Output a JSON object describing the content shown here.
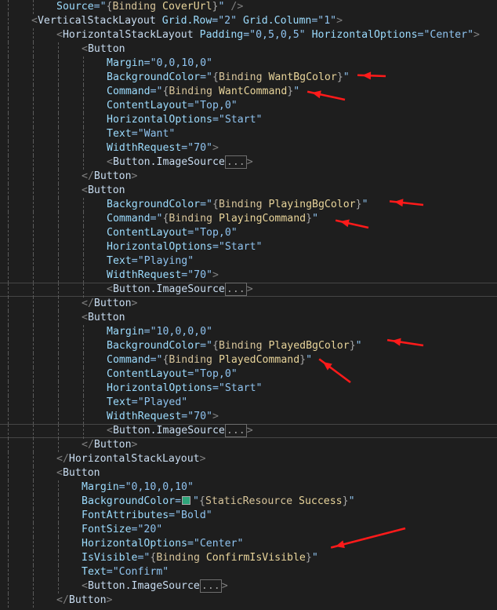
{
  "editor": {
    "accent_arrow": "#ff1a1a",
    "lines": [
      {
        "i": 2,
        "t": [
          [
            "a",
            "Source"
          ],
          [
            "q",
            "=\""
          ],
          [
            "m",
            "{"
          ],
          [
            "k",
            "Binding "
          ],
          [
            "n",
            "CoverUrl"
          ],
          [
            "m",
            "}"
          ],
          [
            "q",
            "\""
          ],
          [
            "b",
            " />"
          ]
        ]
      },
      {
        "i": 1,
        "t": [
          [
            "b",
            "<"
          ],
          [
            "e",
            "VerticalStackLayout"
          ],
          [
            "a",
            " Grid.Row"
          ],
          [
            "q",
            "=\"2\""
          ],
          [
            "a",
            " Grid.Column"
          ],
          [
            "q",
            "=\"1\""
          ],
          [
            "b",
            ">"
          ]
        ]
      },
      {
        "i": 2,
        "t": [
          [
            "b",
            "<"
          ],
          [
            "e",
            "HorizontalStackLayout"
          ],
          [
            "a",
            " Padding"
          ],
          [
            "q",
            "=\"0,5,0,5\""
          ],
          [
            "a",
            " HorizontalOptions"
          ],
          [
            "q",
            "=\"Center\""
          ],
          [
            "b",
            ">"
          ]
        ]
      },
      {
        "i": 3,
        "t": [
          [
            "b",
            "<"
          ],
          [
            "e",
            "Button"
          ]
        ]
      },
      {
        "i": 4,
        "t": [
          [
            "a",
            "Margin"
          ],
          [
            "q",
            "=\"0,0,10,0\""
          ]
        ]
      },
      {
        "i": 4,
        "t": [
          [
            "a",
            "BackgroundColor"
          ],
          [
            "q",
            "=\""
          ],
          [
            "m",
            "{"
          ],
          [
            "k",
            "Binding "
          ],
          [
            "n",
            "WantBgColor"
          ],
          [
            "m",
            "}"
          ],
          [
            "q",
            "\""
          ]
        ]
      },
      {
        "i": 4,
        "t": [
          [
            "a",
            "Command"
          ],
          [
            "q",
            "=\""
          ],
          [
            "m",
            "{"
          ],
          [
            "k",
            "Binding "
          ],
          [
            "n",
            "WantCommand"
          ],
          [
            "m",
            "}"
          ],
          [
            "q",
            "\""
          ]
        ]
      },
      {
        "i": 4,
        "t": [
          [
            "a",
            "ContentLayout"
          ],
          [
            "q",
            "=\"Top,0\""
          ]
        ]
      },
      {
        "i": 4,
        "t": [
          [
            "a",
            "HorizontalOptions"
          ],
          [
            "q",
            "=\"Start\""
          ]
        ]
      },
      {
        "i": 4,
        "t": [
          [
            "a",
            "Text"
          ],
          [
            "q",
            "=\"Want\""
          ]
        ]
      },
      {
        "i": 4,
        "t": [
          [
            "a",
            "WidthRequest"
          ],
          [
            "q",
            "=\"70\""
          ],
          [
            "b",
            ">"
          ]
        ]
      },
      {
        "i": 4,
        "t": [
          [
            "b",
            "<"
          ],
          [
            "e",
            "Button.ImageSource"
          ],
          [
            "fold",
            "..."
          ],
          [
            "b",
            ">"
          ]
        ]
      },
      {
        "i": 3,
        "t": [
          [
            "b",
            "</"
          ],
          [
            "e",
            "Button"
          ],
          [
            "b",
            ">"
          ]
        ]
      },
      {
        "i": 3,
        "t": [
          [
            "b",
            "<"
          ],
          [
            "e",
            "Button"
          ]
        ]
      },
      {
        "i": 4,
        "t": [
          [
            "a",
            "BackgroundColor"
          ],
          [
            "q",
            "=\""
          ],
          [
            "m",
            "{"
          ],
          [
            "k",
            "Binding "
          ],
          [
            "n",
            "PlayingBgColor"
          ],
          [
            "m",
            "}"
          ],
          [
            "q",
            "\""
          ]
        ]
      },
      {
        "i": 4,
        "t": [
          [
            "a",
            "Command"
          ],
          [
            "q",
            "=\""
          ],
          [
            "m",
            "{"
          ],
          [
            "k",
            "Binding "
          ],
          [
            "n",
            "PlayingCommand"
          ],
          [
            "m",
            "}"
          ],
          [
            "q",
            "\""
          ]
        ]
      },
      {
        "i": 4,
        "t": [
          [
            "a",
            "ContentLayout"
          ],
          [
            "q",
            "=\"Top,0\""
          ]
        ]
      },
      {
        "i": 4,
        "t": [
          [
            "a",
            "HorizontalOptions"
          ],
          [
            "q",
            "=\"Start\""
          ]
        ]
      },
      {
        "i": 4,
        "t": [
          [
            "a",
            "Text"
          ],
          [
            "q",
            "=\"Playing\""
          ]
        ]
      },
      {
        "i": 4,
        "t": [
          [
            "a",
            "WidthRequest"
          ],
          [
            "q",
            "=\"70\""
          ],
          [
            "b",
            ">"
          ]
        ]
      },
      {
        "i": 4,
        "cur": true,
        "t": [
          [
            "b",
            "<"
          ],
          [
            "e",
            "Button.ImageSource"
          ],
          [
            "fold",
            "..."
          ],
          [
            "b",
            ">"
          ]
        ]
      },
      {
        "i": 3,
        "t": [
          [
            "b",
            "</"
          ],
          [
            "e",
            "Button"
          ],
          [
            "b",
            ">"
          ]
        ]
      },
      {
        "i": 3,
        "t": [
          [
            "b",
            "<"
          ],
          [
            "e",
            "Button"
          ]
        ]
      },
      {
        "i": 4,
        "t": [
          [
            "a",
            "Margin"
          ],
          [
            "q",
            "=\"10,0,0,0\""
          ]
        ]
      },
      {
        "i": 4,
        "t": [
          [
            "a",
            "BackgroundColor"
          ],
          [
            "q",
            "=\""
          ],
          [
            "m",
            "{"
          ],
          [
            "k",
            "Binding "
          ],
          [
            "n",
            "PlayedBgColor"
          ],
          [
            "m",
            "}"
          ],
          [
            "q",
            "\""
          ]
        ]
      },
      {
        "i": 4,
        "t": [
          [
            "a",
            "Command"
          ],
          [
            "q",
            "=\""
          ],
          [
            "m",
            "{"
          ],
          [
            "k",
            "Binding "
          ],
          [
            "n",
            "PlayedCommand"
          ],
          [
            "m",
            "}"
          ],
          [
            "q",
            "\""
          ]
        ]
      },
      {
        "i": 4,
        "t": [
          [
            "a",
            "ContentLayout"
          ],
          [
            "q",
            "=\"Top,0\""
          ]
        ]
      },
      {
        "i": 4,
        "t": [
          [
            "a",
            "HorizontalOptions"
          ],
          [
            "q",
            "=\"Start\""
          ]
        ]
      },
      {
        "i": 4,
        "t": [
          [
            "a",
            "Text"
          ],
          [
            "q",
            "=\"Played\""
          ]
        ]
      },
      {
        "i": 4,
        "t": [
          [
            "a",
            "WidthRequest"
          ],
          [
            "q",
            "=\"70\""
          ],
          [
            "b",
            ">"
          ]
        ]
      },
      {
        "i": 4,
        "cur": true,
        "t": [
          [
            "b",
            "<"
          ],
          [
            "e",
            "Button.ImageSource"
          ],
          [
            "fold",
            "..."
          ],
          [
            "b",
            ">"
          ]
        ]
      },
      {
        "i": 3,
        "t": [
          [
            "b",
            "</"
          ],
          [
            "e",
            "Button"
          ],
          [
            "b",
            ">"
          ]
        ]
      },
      {
        "i": 2,
        "t": [
          [
            "b",
            "</"
          ],
          [
            "e",
            "HorizontalStackLayout"
          ],
          [
            "b",
            ">"
          ]
        ]
      },
      {
        "i": 2,
        "t": [
          [
            "b",
            "<"
          ],
          [
            "e",
            "Button"
          ]
        ]
      },
      {
        "i": 3,
        "t": [
          [
            "a",
            "Margin"
          ],
          [
            "q",
            "=\"0,10,0,10\""
          ]
        ]
      },
      {
        "i": 3,
        "t": [
          [
            "a",
            "BackgroundColor"
          ],
          [
            "q",
            "="
          ],
          [
            "sw",
            ""
          ],
          [
            "q",
            "\""
          ],
          [
            "m",
            "{"
          ],
          [
            "k",
            "StaticResource "
          ],
          [
            "n",
            "Success"
          ],
          [
            "m",
            "}"
          ],
          [
            "q",
            "\""
          ]
        ]
      },
      {
        "i": 3,
        "t": [
          [
            "a",
            "FontAttributes"
          ],
          [
            "q",
            "=\"Bold\""
          ]
        ]
      },
      {
        "i": 3,
        "t": [
          [
            "a",
            "FontSize"
          ],
          [
            "q",
            "=\"20\""
          ]
        ]
      },
      {
        "i": 3,
        "t": [
          [
            "a",
            "HorizontalOptions"
          ],
          [
            "q",
            "=\"Center\""
          ]
        ]
      },
      {
        "i": 3,
        "t": [
          [
            "a",
            "IsVisible"
          ],
          [
            "q",
            "=\""
          ],
          [
            "m",
            "{"
          ],
          [
            "k",
            "Binding "
          ],
          [
            "n",
            "ConfirmIsVisible"
          ],
          [
            "m",
            "}"
          ],
          [
            "q",
            "\""
          ]
        ]
      },
      {
        "i": 3,
        "t": [
          [
            "a",
            "Text"
          ],
          [
            "q",
            "=\"Confirm\""
          ]
        ]
      },
      {
        "i": 3,
        "t": [
          [
            "b",
            "<"
          ],
          [
            "e",
            "Button.ImageSource"
          ],
          [
            "fold",
            "..."
          ],
          [
            "b",
            ">"
          ]
        ]
      },
      {
        "i": 2,
        "t": [
          [
            "b",
            "</"
          ],
          [
            "e",
            "Button"
          ],
          [
            "b",
            ">"
          ]
        ]
      }
    ]
  }
}
